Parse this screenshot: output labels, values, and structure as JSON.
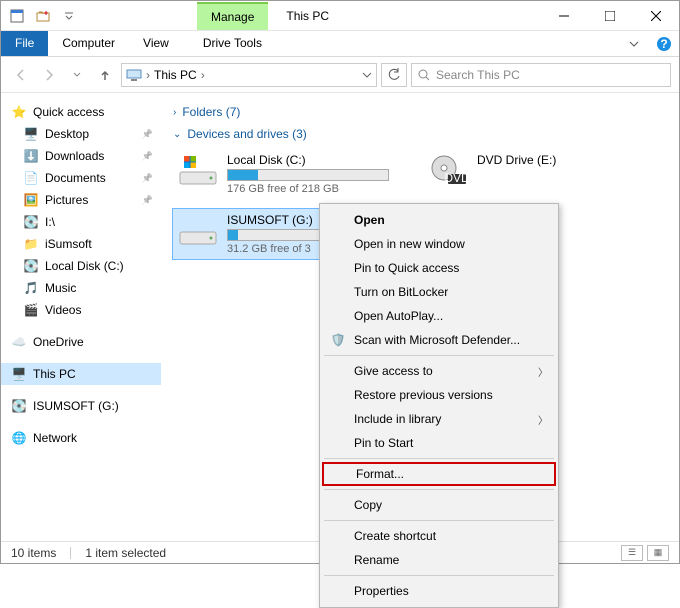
{
  "title": "This PC",
  "manage_tab": "Manage",
  "ribbon": {
    "file": "File",
    "computer": "Computer",
    "view": "View",
    "drive_tools": "Drive Tools"
  },
  "breadcrumb": {
    "root": "This PC"
  },
  "search": {
    "placeholder": "Search This PC"
  },
  "sidebar": {
    "quick": "Quick access",
    "items_quick": [
      {
        "label": "Desktop"
      },
      {
        "label": "Downloads"
      },
      {
        "label": "Documents"
      },
      {
        "label": "Pictures"
      },
      {
        "label": "I:\\"
      },
      {
        "label": "iSumsoft"
      },
      {
        "label": "Local Disk (C:)"
      },
      {
        "label": "Music"
      },
      {
        "label": "Videos"
      }
    ],
    "onedrive": "OneDrive",
    "thispc": "This PC",
    "isumsoft": "ISUMSOFT (G:)",
    "network": "Network"
  },
  "groups": {
    "folders": "Folders (7)",
    "drives_hdr": "Devices and drives (3)"
  },
  "drives": [
    {
      "name": "Local Disk (C:)",
      "free": "176 GB free of 218 GB",
      "fill": 19
    },
    {
      "name": "DVD Drive (E:)",
      "free": "",
      "fill": null
    },
    {
      "name": "ISUMSOFT (G:)",
      "free": "31.2 GB free of 3",
      "fill": 6
    }
  ],
  "context": {
    "open": "Open",
    "new_window": "Open in new window",
    "pin_quick": "Pin to Quick access",
    "bitlocker": "Turn on BitLocker",
    "autoplay": "Open AutoPlay...",
    "defender": "Scan with Microsoft Defender...",
    "give_access": "Give access to",
    "restore": "Restore previous versions",
    "include_lib": "Include in library",
    "pin_start": "Pin to Start",
    "format": "Format...",
    "copy": "Copy",
    "shortcut": "Create shortcut",
    "rename": "Rename",
    "properties": "Properties"
  },
  "status": {
    "items": "10 items",
    "selected": "1 item selected"
  }
}
